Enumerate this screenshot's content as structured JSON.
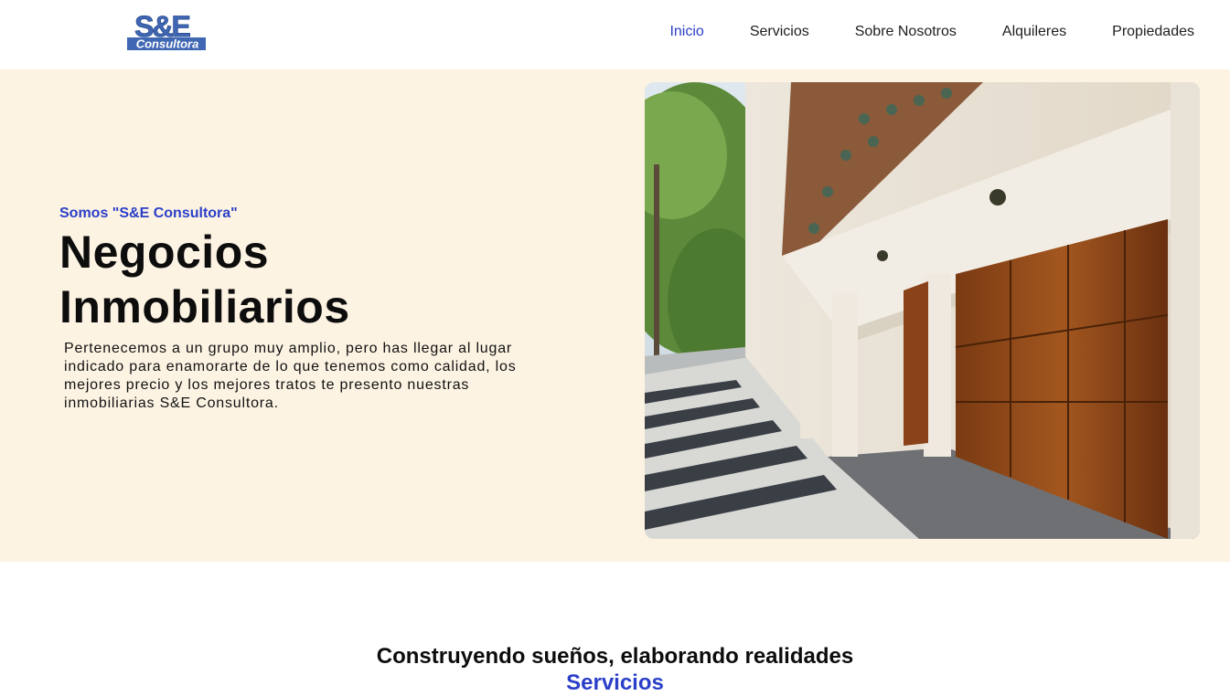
{
  "header": {
    "logo": {
      "text_top": "S&E",
      "text_bottom": "Consultora",
      "color": "#3f67b3"
    },
    "nav": [
      {
        "label": "Inicio",
        "active": true
      },
      {
        "label": "Servicios",
        "active": false
      },
      {
        "label": "Sobre Nosotros",
        "active": false
      },
      {
        "label": "Alquileres",
        "active": false
      },
      {
        "label": "Propiedades",
        "active": false
      }
    ]
  },
  "hero": {
    "eyebrow": "Somos \"S&E Consultora\"",
    "title_line1": "Negocios",
    "title_line2": "Inmobiliarios",
    "text": "Pertenecemos a un grupo muy amplio, pero has llegar al lugar indicado para enamorarte de lo que tenemos como calidad, los mejores precio y los mejores tratos te presento nuestras inmobiliarias S&E Consultora.",
    "background": "#fdf3e3",
    "image_subject": "street facade with wooden garage doors"
  },
  "section": {
    "tagline": "Construyendo sueños, elaborando realidades",
    "subtitle": "Servicios"
  },
  "colors": {
    "accent": "#2b3fc8",
    "text": "#0d0d0d"
  }
}
